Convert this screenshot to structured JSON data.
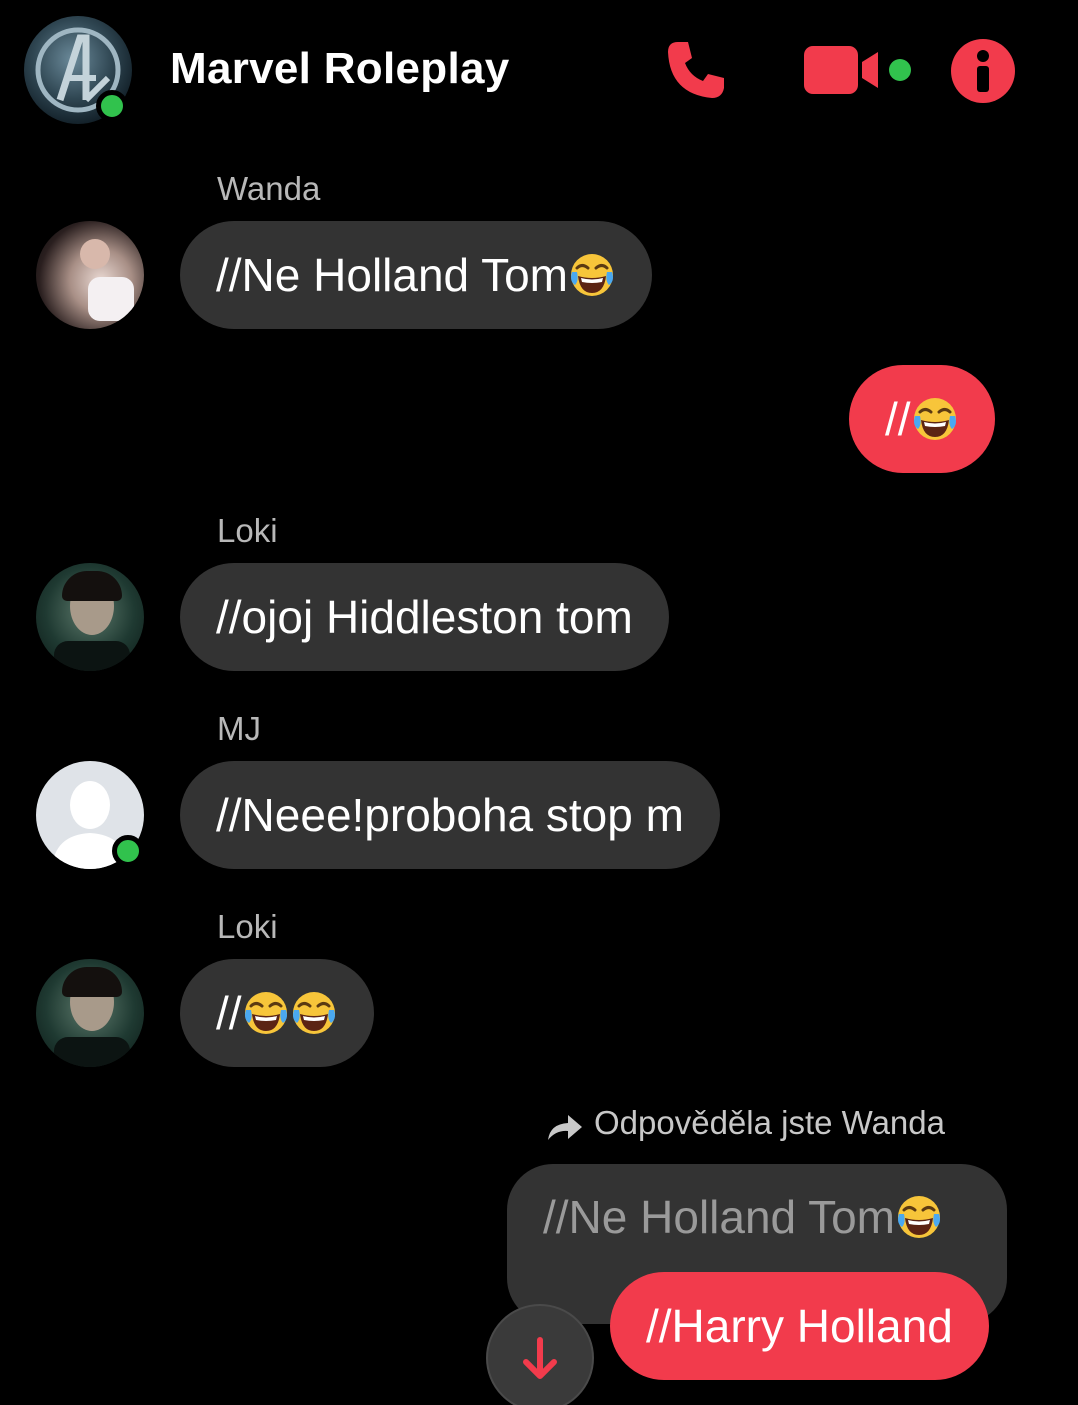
{
  "header": {
    "title": "Marvel Roleplay",
    "accent_color": "#f23b4c",
    "online_color": "#31c24d",
    "icons": [
      "phone-icon",
      "video-camera-icon",
      "info-icon"
    ]
  },
  "messages": [
    {
      "sender": "Wanda",
      "text": "//Ne Holland Tom",
      "emoji_count": 1,
      "direction": "incoming"
    },
    {
      "text": "//",
      "emoji_count": 1,
      "direction": "outgoing"
    },
    {
      "sender": "Loki",
      "text": "//ojoj Hiddleston tom",
      "direction": "incoming"
    },
    {
      "sender": "MJ",
      "text": "//Neee!proboha stop m",
      "direction": "incoming"
    },
    {
      "sender": "Loki",
      "text": "//",
      "emoji_count": 2,
      "direction": "incoming"
    }
  ],
  "reply": {
    "label": "Odpověděla jste Wanda",
    "quoted_text": "//Ne Holland Tom",
    "reply_text": "//Harry Holland"
  },
  "colors": {
    "incoming_bubble": "#333333",
    "outgoing_bubble": "#f23b4c",
    "background": "#000000"
  }
}
